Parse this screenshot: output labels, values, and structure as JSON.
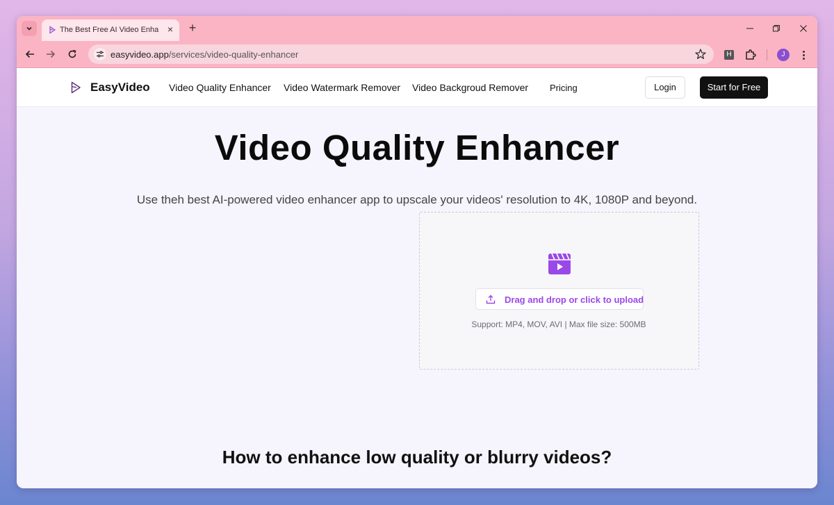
{
  "browser": {
    "tab_title": "The Best Free AI Video Enhancer",
    "url_host": "easyvideo.app",
    "url_path": "/services/video-quality-enhancer",
    "profile_initial": "J",
    "extension_letter": "H"
  },
  "site": {
    "logo_text": "EasyVideo",
    "nav": [
      "Video Quality Enhancer",
      "Video Watermark Remover",
      "Video Backgroud Remover",
      "Pricing"
    ],
    "login_label": "Login",
    "start_label": "Start for Free"
  },
  "hero": {
    "title": "Video Quality Enhancer",
    "subtitle": "Use theh best AI-powered video enhancer app to upscale your videos' resolution to 4K, 1080P and beyond."
  },
  "upload": {
    "button_label": "Drag and drop or click to upload",
    "support_text": "Support: MP4, MOV, AVI | Max file size: 500MB"
  },
  "how_to": {
    "title": "How to enhance low quality or blurry videos?"
  },
  "colors": {
    "accent": "#9b48e8",
    "browser_chrome": "#fbb4c3"
  }
}
